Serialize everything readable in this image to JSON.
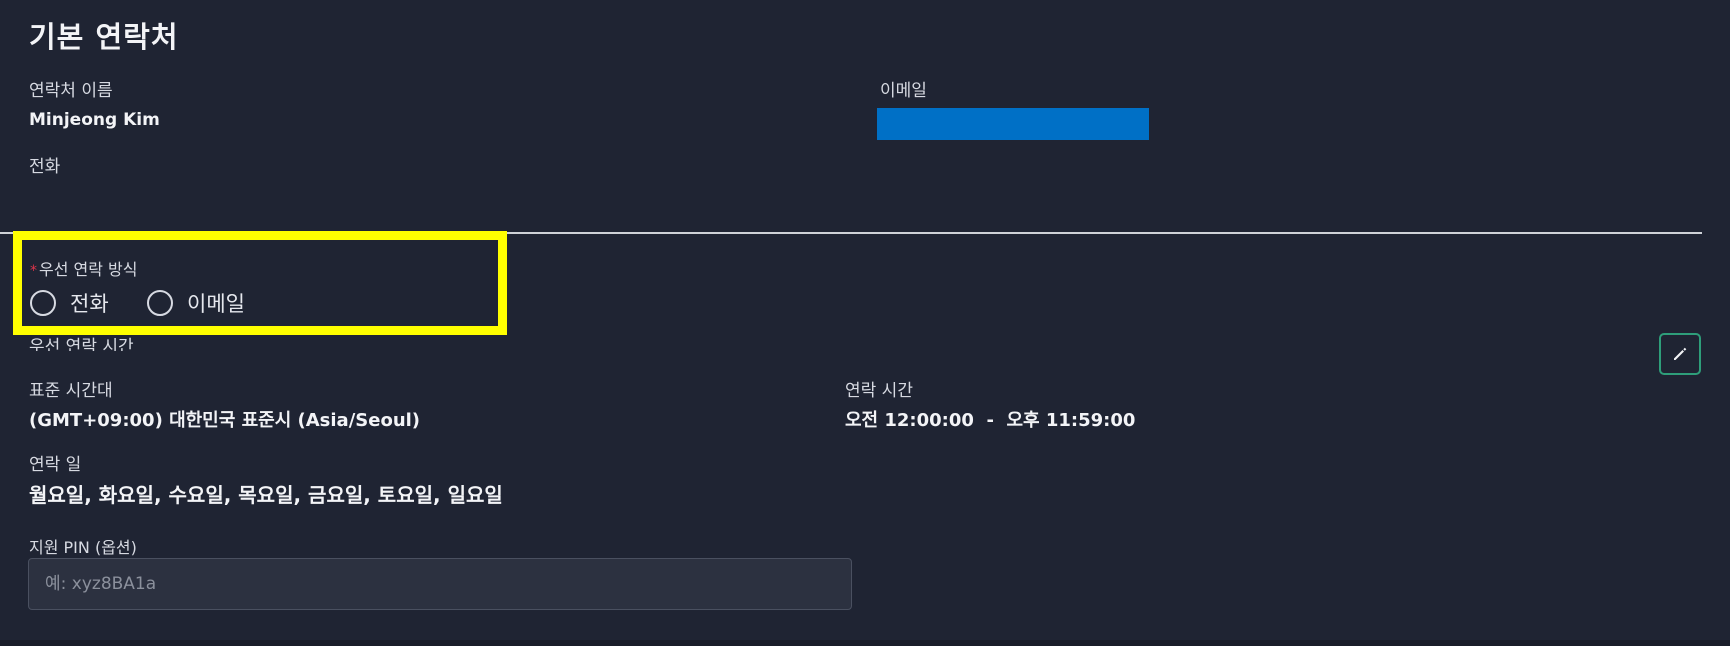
{
  "section": {
    "title": "기본 연락처"
  },
  "contact": {
    "name_label": "연락처 이름",
    "name_value": "Minjeong Kim",
    "email_label": "이메일",
    "email_value": "",
    "phone_label": "전화"
  },
  "preferred_method": {
    "label": "우선 연락 방식",
    "required": "*",
    "options": [
      {
        "label": "전화",
        "selected": false
      },
      {
        "label": "이메일",
        "selected": false
      }
    ]
  },
  "preferred_time": {
    "section_label": "우선 연락 시간",
    "timezone_label": "표준 시간대",
    "timezone_value": "(GMT+09:00) 대한민국 표준시 (Asia/Seoul)",
    "contact_time_label": "연락 시간",
    "contact_time_value": "오전 12:00:00  -  오후 11:59:00",
    "contact_days_label": "연락 일",
    "contact_days_value": "월요일, 화요일, 수요일, 목요일, 금요일, 토요일, 일요일"
  },
  "support_pin": {
    "label": "지원 PIN (옵션)",
    "placeholder": "예: xyz8BA1a",
    "value": ""
  },
  "colors": {
    "background": "#1f2433",
    "highlight": "#ffff00",
    "email_redaction": "#0070c6",
    "edit_button_border": "#2e9e7a",
    "required_star": "#e0354b"
  },
  "icons": {
    "edit": "pencil-icon"
  }
}
